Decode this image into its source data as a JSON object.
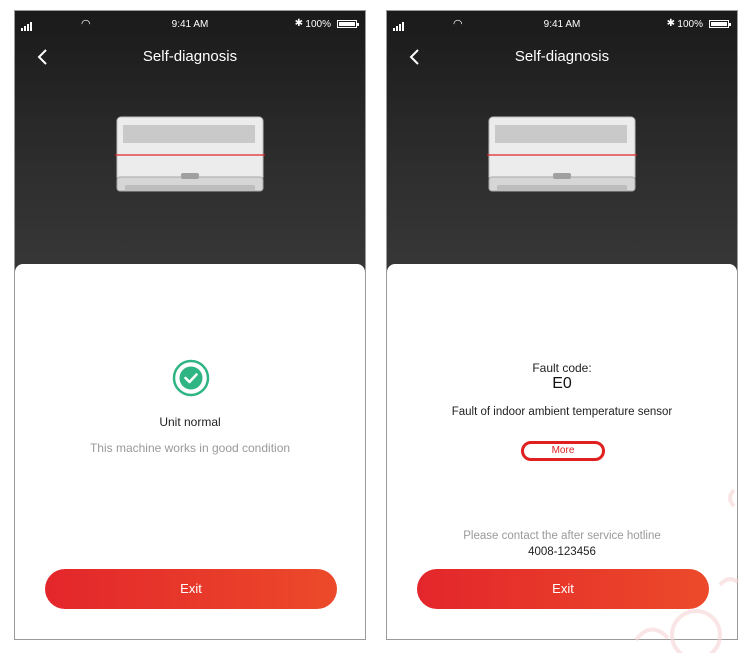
{
  "status_bar": {
    "time": "9:41 AM",
    "battery_text": "100%"
  },
  "header": {
    "title": "Self-diagnosis",
    "back_icon": "chevron-left-icon"
  },
  "left_screen": {
    "status_icon": "check-circle-icon",
    "status_title": "Unit normal",
    "status_desc": "This machine works in good condition",
    "exit_label": "Exit"
  },
  "right_screen": {
    "fault_label": "Fault code:",
    "fault_code": "E0",
    "fault_desc": "Fault of indoor ambient temperature sensor",
    "more_label": "More",
    "contact_text": "Please contact the after service hotline",
    "hotline": "4008-123456",
    "exit_label": "Exit"
  },
  "colors": {
    "accent": "#e3262b",
    "check": "#2fb584",
    "header_bg": "#1f1f1f"
  }
}
